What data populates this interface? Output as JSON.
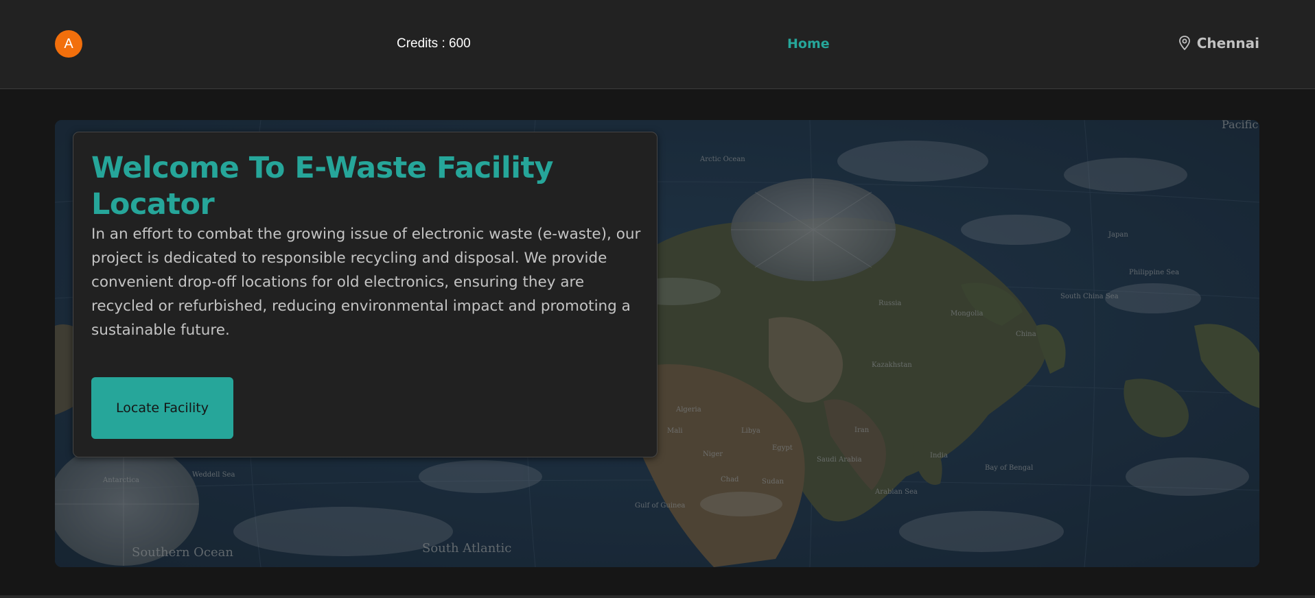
{
  "navbar": {
    "avatar_initial": "A",
    "credits": "Credits : 600",
    "home_link": "Home",
    "location": "Chennai",
    "location_icon": "map-pin-icon",
    "colors": {
      "background": "#222222",
      "accent": "#26a69a",
      "avatar": "#f26f0c"
    }
  },
  "hero": {
    "background": "world-map-satellite",
    "title": "Welcome To E-Waste Facility Locator",
    "description": "In an effort to combat the growing issue of electronic waste (e-waste), our project is dedicated to responsible recycling and disposal. We provide convenient drop-off locations for old electronics, ensuring they are recycled or refurbished, reducing environmental impact and promoting a sustainable future.",
    "cta_label": "Locate Facility",
    "map_labels": {
      "arctic_ocean": "Arctic Ocean",
      "pacific_ocean": "Pacific Ocean",
      "russia": "Russia",
      "mongolia": "Mongolia",
      "china": "China",
      "kazakhstan": "Kazakhstan",
      "japan": "Japan",
      "algeria": "Algeria",
      "libya": "Libya",
      "egypt": "Egypt",
      "mali": "Mali",
      "niger": "Niger",
      "chad": "Chad",
      "sudan": "Sudan",
      "saudi_arabia": "Saudi Arabia",
      "iran": "Iran",
      "india": "India",
      "bay_of_bengal": "Bay of Bengal",
      "arabian_sea": "Arabian Sea",
      "antarctica": "Antarctica",
      "south_atlantic": "South Atlantic",
      "southern_ocean": "Southern Ocean",
      "philippine_sea": "Philippine Sea",
      "south_china_sea": "South China Sea",
      "weddell_sea": "Weddell Sea",
      "gulf_of_guinea": "Gulf of Guinea"
    }
  }
}
